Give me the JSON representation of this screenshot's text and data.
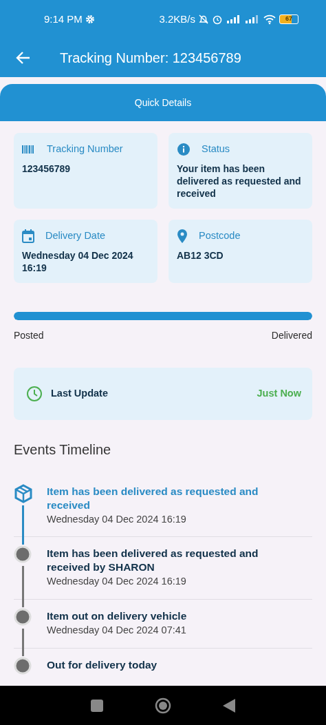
{
  "status_bar": {
    "time": "9:14 PM",
    "speed": "3.2KB/s",
    "battery": "67"
  },
  "app_bar": {
    "title": "Tracking Number: 123456789"
  },
  "quick_details": {
    "title": "Quick Details"
  },
  "details": [
    {
      "kind": "barcode",
      "label": "Tracking Number",
      "value": "123456789"
    },
    {
      "kind": "info",
      "label": "Status",
      "value": "Your item has been delivered as requested and received"
    },
    {
      "kind": "calendar",
      "label": "Delivery Date",
      "value": "Wednesday 04 Dec 2024 16:19"
    },
    {
      "kind": "pin",
      "label": "Postcode",
      "value": "AB12 3CD"
    }
  ],
  "progress": {
    "level": 1,
    "start_label": "Posted",
    "end_label": "Delivered"
  },
  "last_update": {
    "label": "Last Update",
    "value": "Just Now"
  },
  "timeline": {
    "title": "Events Timeline",
    "events": [
      {
        "kind": "current",
        "title": "Item has been delivered as requested and received",
        "date": "Wednesday 04 Dec 2024 16:19"
      },
      {
        "kind": "past",
        "title": "Item has been delivered as requested and received by SHARON",
        "date": "Wednesday 04 Dec 2024 16:19"
      },
      {
        "kind": "past",
        "title": "Item out on delivery vehicle",
        "date": "Wednesday 04 Dec 2024 07:41"
      },
      {
        "kind": "past",
        "title": "Out for delivery today"
      }
    ]
  }
}
